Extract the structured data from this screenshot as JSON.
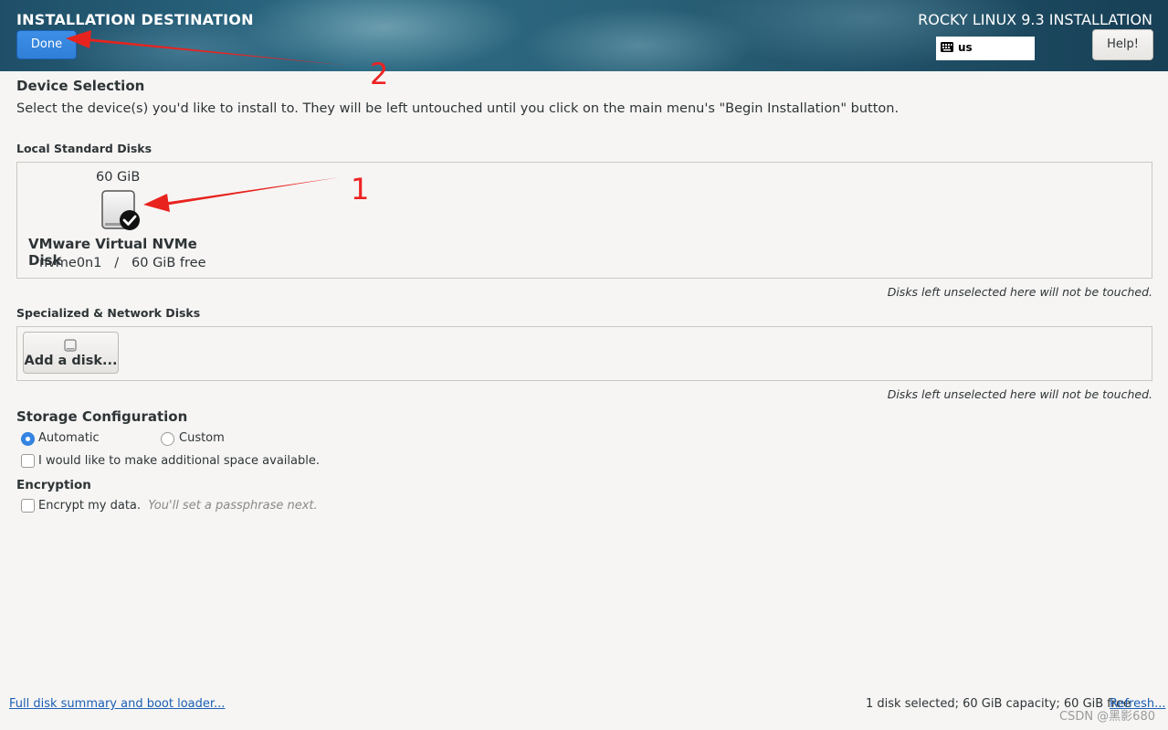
{
  "header": {
    "title": "INSTALLATION DESTINATION",
    "done_label": "Done",
    "product_title": "ROCKY LINUX 9.3 INSTALLATION",
    "keyboard_layout": "us",
    "help_label": "Help!"
  },
  "device_selection": {
    "heading": "Device Selection",
    "description": "Select the device(s) you'd like to install to.  They will be left untouched until you click on the main menu's \"Begin Installation\" button."
  },
  "local_disks": {
    "label": "Local Standard Disks",
    "disks": [
      {
        "size": "60 GiB",
        "name": "VMware Virtual NVMe Disk",
        "device": "nvme0n1",
        "separator": "/",
        "free": "60 GiB free",
        "selected": true
      }
    ],
    "note": "Disks left unselected here will not be touched."
  },
  "specialized_disks": {
    "label": "Specialized & Network Disks",
    "add_button_label": "Add a disk...",
    "note": "Disks left unselected here will not be touched."
  },
  "storage_configuration": {
    "heading": "Storage Configuration",
    "options": [
      {
        "label": "Automatic",
        "checked": true
      },
      {
        "label": "Custom",
        "checked": false
      }
    ],
    "additional_space_label": "I would like to make additional space available."
  },
  "encryption": {
    "heading": "Encryption",
    "checkbox_label": "Encrypt my data.",
    "hint": "You'll set a passphrase next."
  },
  "footer": {
    "summary_link": "Full disk summary and boot loader...",
    "status": "1 disk selected; 60 GiB capacity; 60 GiB free",
    "refresh_link": "Refresh...",
    "watermark": "CSDN @黑影680"
  },
  "annotations": {
    "callout_1": "1",
    "callout_2": "2",
    "arrow_color": "#e8231e"
  },
  "colors": {
    "accent": "#3584e4",
    "link": "#1a5fb4",
    "header_bg": "#2a6178"
  }
}
